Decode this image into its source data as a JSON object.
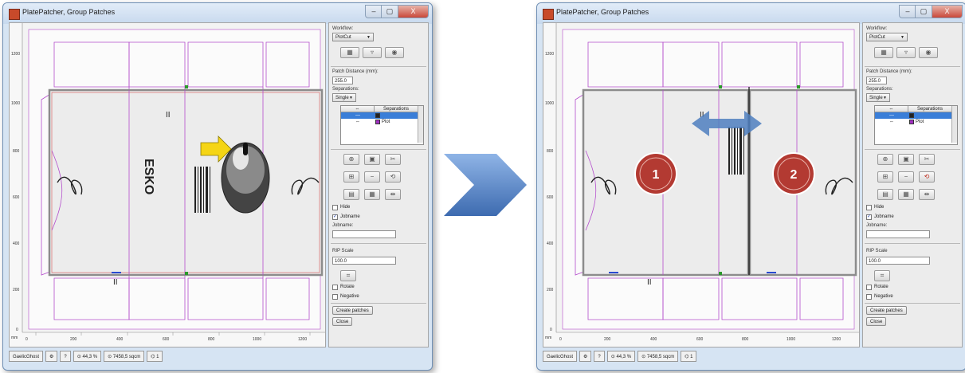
{
  "window_title": "PlatePatcher,  Group Patches",
  "window_controls": {
    "minimize": "–",
    "maximize": "▢",
    "close": "X"
  },
  "panel": {
    "workflow_label": "Workflow:",
    "workflow_value": "PlotCut",
    "patch_distance_label": "Patch Distance (mm):",
    "patch_distance_value": "255.0",
    "separations_label": "Separations:",
    "separations_mode": "Single",
    "sep_table_headers": [
      "⇔",
      "Separations"
    ],
    "sep_rows": [
      {
        "mark": "—",
        "name": "",
        "color": "#222222",
        "selected": true
      },
      {
        "mark": "⇔",
        "name": "Plot",
        "color": "#a030c0",
        "selected": false
      }
    ],
    "hide_label": "Hide",
    "hide_checked": false,
    "jobname_check_label": "Jobname",
    "jobname_checked": true,
    "jobname_label": "Jobname:",
    "jobname_value": "",
    "rip_scale_label": "RIP Scale",
    "rip_scale_value": "100.0",
    "rotate_label": "Rotate",
    "negative_label": "Negative",
    "create_patches_label": "Create patches",
    "close_label": "Close"
  },
  "status_bar": {
    "name": "GaelicGhost",
    "zoom": "44,3 %",
    "area": "7458,5 sqcm",
    "count": "1"
  },
  "ruler": {
    "unit": "mm",
    "y_ticks": [
      "1200",
      "1000",
      "800",
      "600",
      "400",
      "200",
      "0"
    ],
    "x_ticks": [
      "0",
      "200",
      "400",
      "600",
      "800",
      "1000",
      "1200"
    ]
  },
  "artwork": {
    "brand": "ESKO",
    "patch_numbers": [
      "1",
      "2"
    ]
  },
  "colors": {
    "window_frame": "#d6e4f3",
    "dieline": "#b44dcc",
    "plate_border": "#a0a0a0",
    "patch_badge": "#b33a32",
    "arrow": "#4f7fc0"
  }
}
